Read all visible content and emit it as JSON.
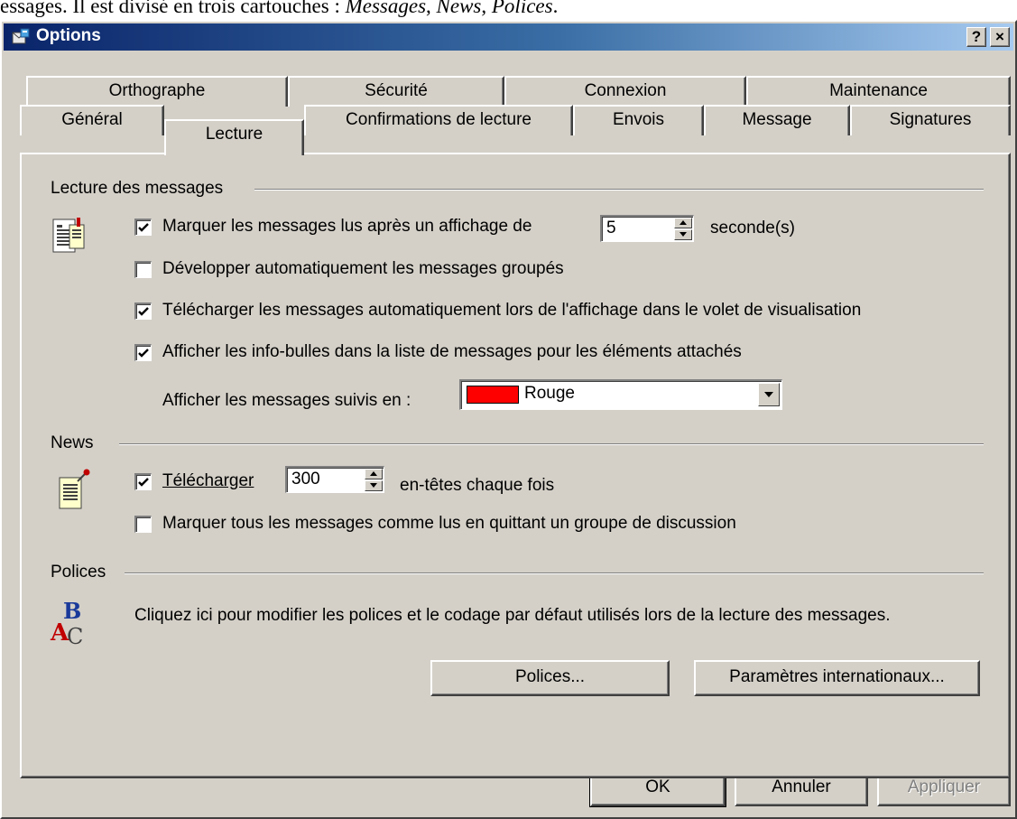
{
  "caption": {
    "lead": "essages. Il est divisé en trois cartouches : ",
    "section1": "Messages",
    "sep1": ", ",
    "section2": "News",
    "sep2": ", ",
    "section3": "Polices",
    "end": "."
  },
  "window": {
    "title": "Options",
    "help_button": "?",
    "close_button": "×"
  },
  "tabs": {
    "row_back": [
      "Orthographe",
      "Sécurité",
      "Connexion",
      "Maintenance"
    ],
    "row_front": [
      "Général",
      "Lecture",
      "Confirmations de lecture",
      "Envois",
      "Message",
      "Signatures"
    ],
    "active": "Lecture"
  },
  "reading": {
    "group_label": "Lecture des messages",
    "mark_read": {
      "checked": true,
      "label": "Marquer les messages lus après un affichage de",
      "value": "5",
      "unit": "seconde(s)"
    },
    "expand_groups": {
      "checked": false,
      "label": "Développer automatiquement les messages groupés"
    },
    "auto_download": {
      "checked": true,
      "label": "Télécharger les messages automatiquement lors de l'affichage dans le volet de visualisation"
    },
    "tooltips": {
      "checked": true,
      "label": "Afficher les info-bulles dans la liste de messages pour les éléments attachés"
    },
    "watched_label": "Afficher les messages suivis en :",
    "watched_value": "Rouge",
    "watched_color": "#ff0000"
  },
  "news": {
    "group_label": "News",
    "download": {
      "checked": true,
      "label": "Télécharger",
      "value": "300",
      "suffix": "en-têtes chaque fois"
    },
    "mark_all": {
      "checked": false,
      "label": "Marquer tous les messages comme lus en quittant un groupe de discussion"
    }
  },
  "fonts": {
    "group_label": "Polices",
    "description": "Cliquez ici pour modifier les polices et le codage par défaut utilisés lors de la lecture des messages.",
    "fonts_button": "Polices...",
    "intl_button": "Paramètres internationaux..."
  },
  "footer": {
    "ok": "OK",
    "cancel": "Annuler",
    "apply": "Appliquer"
  },
  "colors": {
    "face": "#d4d0c8",
    "title_start": "#0a246a",
    "title_end": "#a6caf0"
  }
}
